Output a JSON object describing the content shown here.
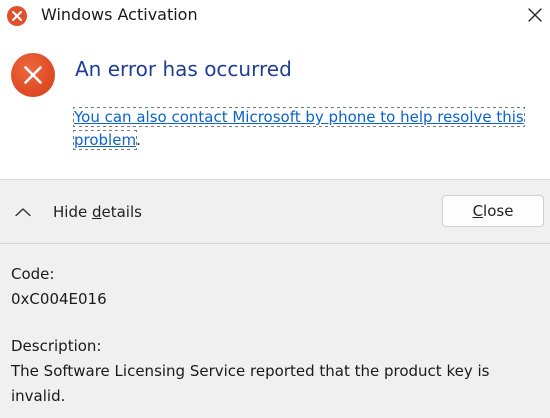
{
  "window": {
    "title": "Windows Activation",
    "close_symbol": "✕"
  },
  "main": {
    "headline": "An error has occurred",
    "contact_link": "You can also contact Microsoft by phone to help resolve this problem",
    "contact_suffix": "."
  },
  "footer": {
    "toggle_prefix": "Hide ",
    "toggle_mnemonic": "d",
    "toggle_suffix": "etails",
    "close_mnemonic": "C",
    "close_suffix": "lose"
  },
  "details": {
    "code_label": "Code:",
    "code_value": "0xC004E016",
    "description_label": "Description:",
    "description_value": "The Software Licensing Service reported that the product key is invalid."
  },
  "icons": {
    "title_icon": "error-icon",
    "big_icon": "error-icon",
    "toggle_icon": "chevron-up-icon",
    "close_icon": "close-icon"
  },
  "colors": {
    "error_red": "#e0502b",
    "headline_blue": "#1f3e96",
    "link_blue": "#0b63ce"
  }
}
